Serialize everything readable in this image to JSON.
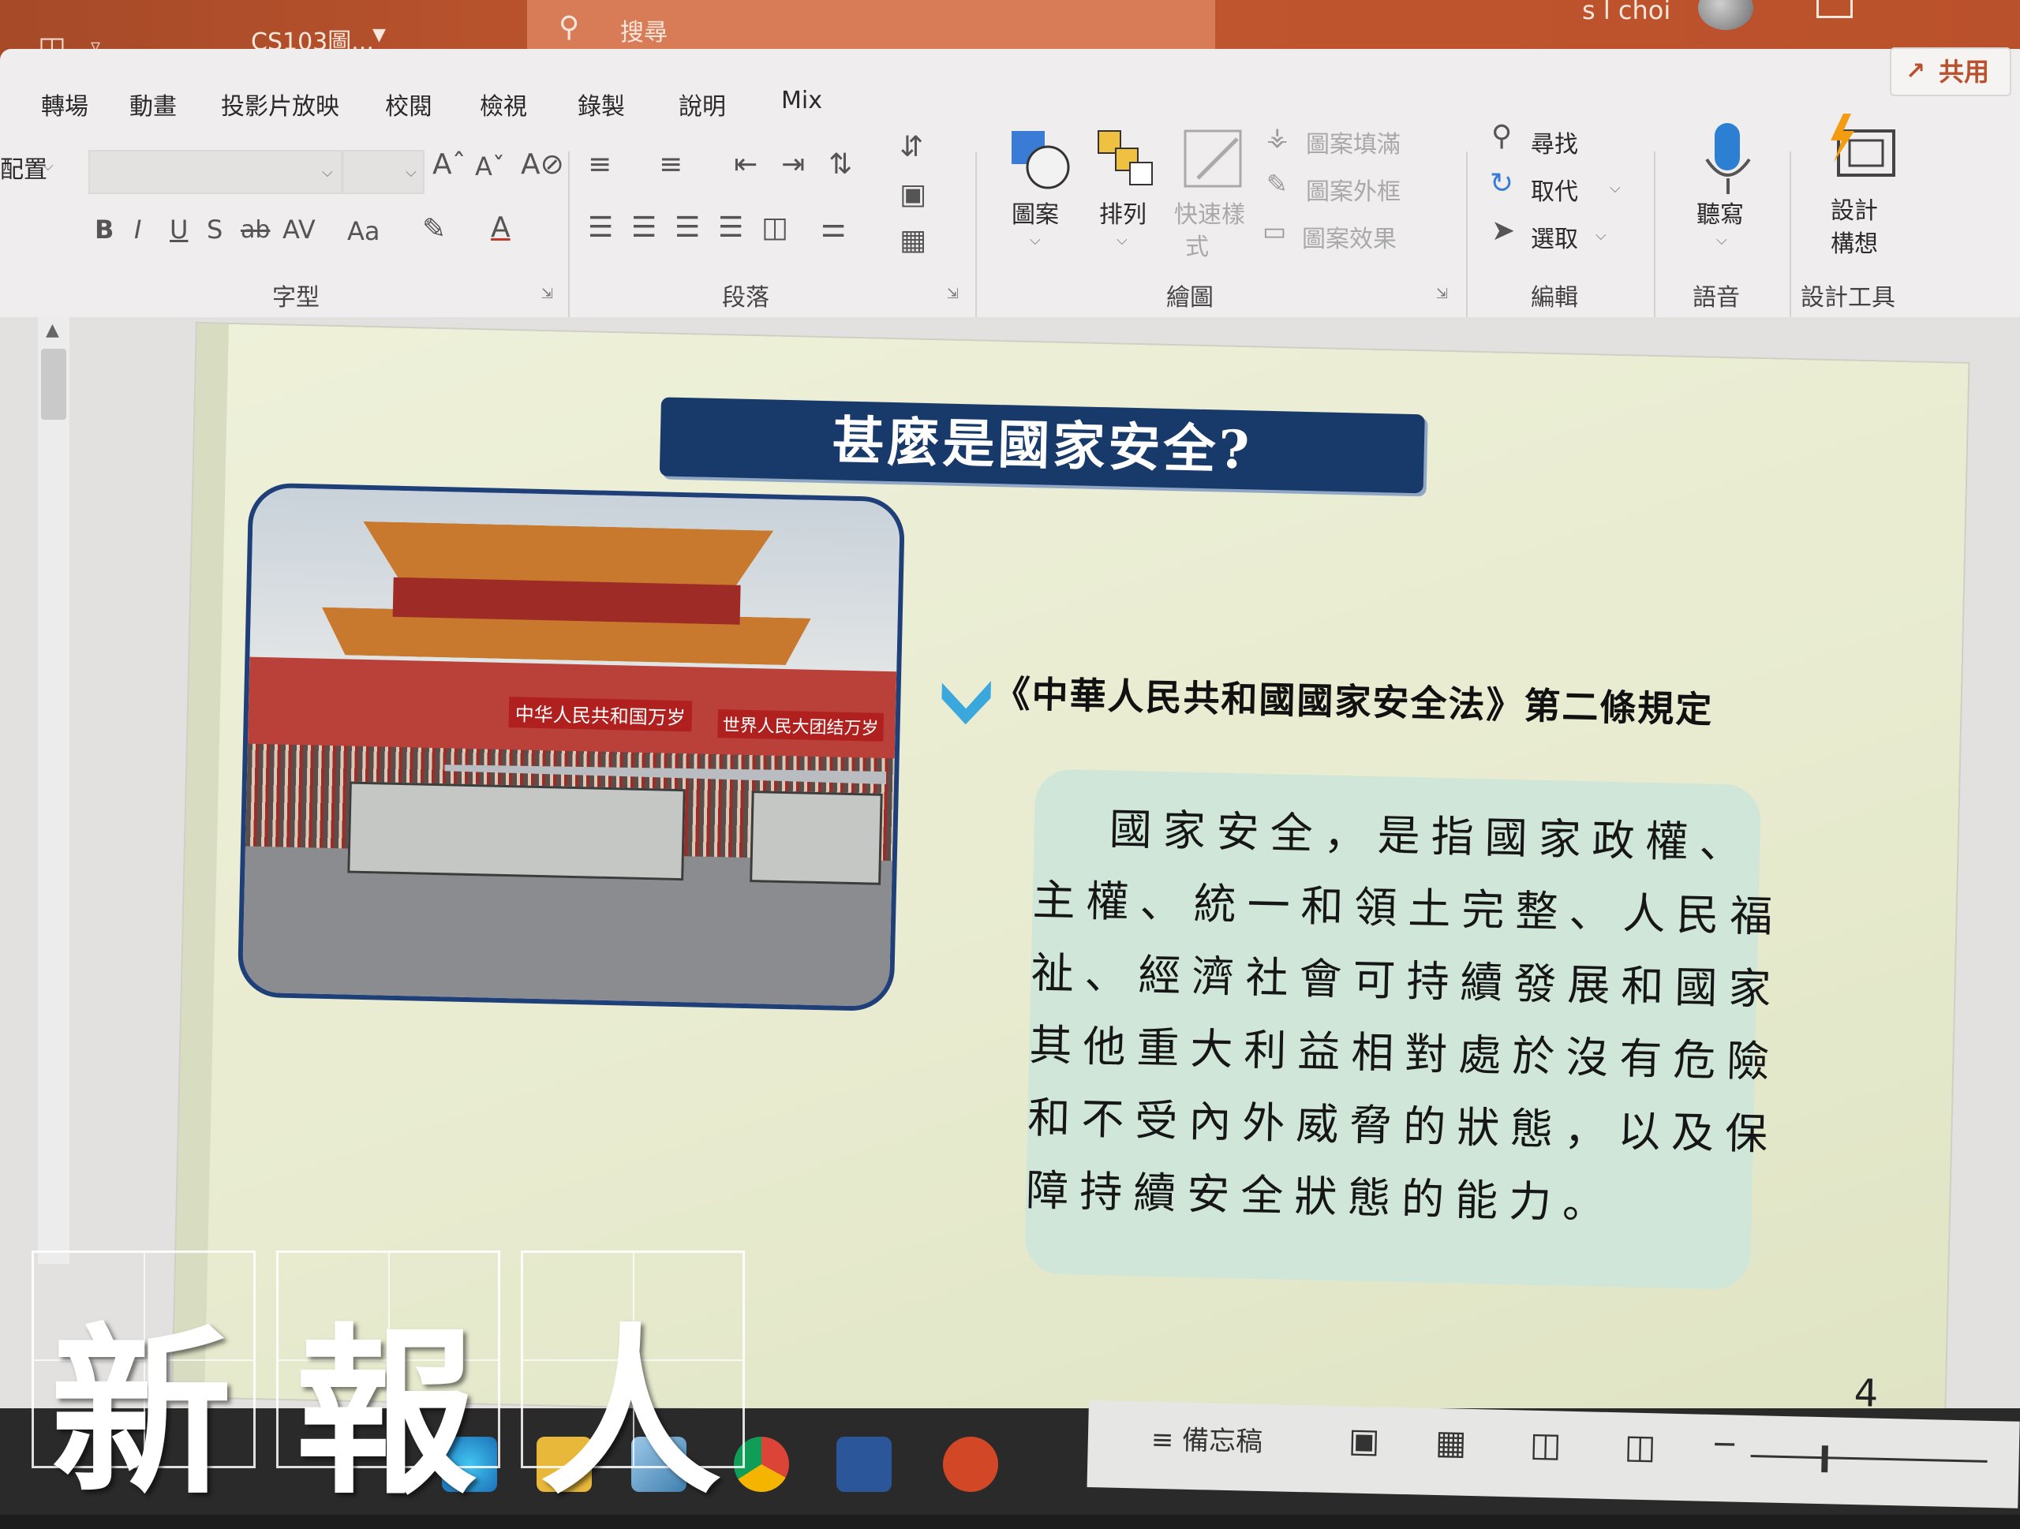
{
  "titlebar": {
    "doc_title": "CS103圖...",
    "search_label": "搜尋",
    "user_name": "s l choi"
  },
  "ribbon": {
    "share_label": "共用",
    "tabs": [
      "轉場",
      "動畫",
      "投影片放映",
      "校閱",
      "檢視",
      "錄製",
      "說明",
      "Mix"
    ],
    "layout_dropdown": "配置",
    "groups": {
      "font": "字型",
      "paragraph": "段落",
      "drawing": "繪圖",
      "editing": "編輯",
      "voice": "語音",
      "designer": "設計工具"
    },
    "drawing": {
      "shapes": "圖案",
      "arrange": "排列",
      "quick_styles_1": "快速樣",
      "quick_styles_2": "式",
      "shape_fill": "圖案填滿",
      "shape_outline": "圖案外框",
      "shape_effects": "圖案效果"
    },
    "editing": {
      "find": "尋找",
      "replace": "取代",
      "select": "選取"
    },
    "voice": {
      "dictate": "聽寫"
    },
    "designer": {
      "ideas_1": "設計",
      "ideas_2": "構想"
    },
    "font_buttons": {
      "bold": "B",
      "italic": "I",
      "underline": "U",
      "shadow": "S",
      "strikethrough": "ab",
      "spacing": "AV",
      "case": "Aa"
    }
  },
  "slide": {
    "title": "甚麼是國家安全?",
    "law_heading": "《中華人民共和國國家安全法》第二條規定",
    "definition_lines": [
      "國家安全，是指國家政權、",
      "主權、統一和領土完整、人民福",
      "祉、經濟社會可持續發展和國家",
      "其他重大利益相對處於沒有危險",
      "和不受內外威脅的狀態，以及保",
      "障持續安全狀態的能力。"
    ],
    "photo_banner_left": "中华人民共和国万岁",
    "photo_banner_right": "世界人民大团结万岁",
    "number": "4"
  },
  "statusbar": {
    "notes_label": "備忘稿"
  },
  "watermark": {
    "chars": [
      "新",
      "報",
      "人"
    ]
  },
  "colors": {
    "titlebar": "#c2572f",
    "title_banner": "#183a6a",
    "definition_box": "#cfe6d9",
    "bullet": "#3aa7dd"
  }
}
